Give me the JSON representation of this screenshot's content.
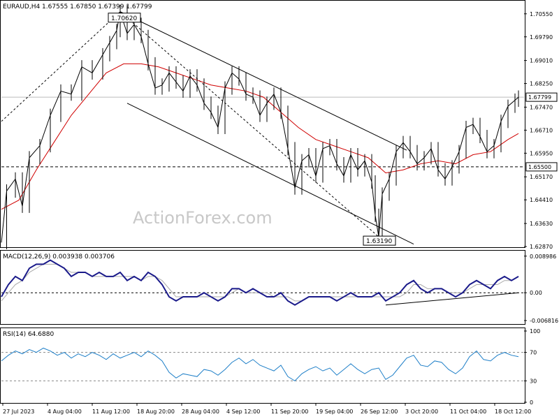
{
  "chart_data": [
    {
      "panel": "price",
      "type": "candlestick",
      "header": "EURAUD,H4  1.67555 1.67850 1.67399 1.67799",
      "watermark": "ActionForex.com",
      "y_ticks": [
        "1.70550",
        "1.69790",
        "1.69010",
        "1.68250",
        "1.67470",
        "1.66710",
        "1.65950",
        "1.65170",
        "1.64410",
        "1.63630",
        "1.62870"
      ],
      "ylim": [
        1.6287,
        1.7096
      ],
      "x_ticks": [
        "27 Jul 2023",
        "4 Aug 04:00",
        "11 Aug 12:00",
        "18 Aug 20:00",
        "28 Aug 04:00",
        "4 Sep 12:00",
        "11 Sep 20:00",
        "19 Sep 04:00",
        "26 Sep 12:00",
        "3 Oct 20:00",
        "11 Oct 04:00",
        "18 Oct 12:00"
      ],
      "price_points": [
        {
          "x": 0,
          "y": 1.63
        },
        {
          "x": 3,
          "y": 1.647
        },
        {
          "x": 8,
          "y": 1.651
        },
        {
          "x": 12,
          "y": 1.642
        },
        {
          "x": 16,
          "y": 1.658
        },
        {
          "x": 22,
          "y": 1.662
        },
        {
          "x": 28,
          "y": 1.672
        },
        {
          "x": 34,
          "y": 1.68
        },
        {
          "x": 40,
          "y": 1.679
        },
        {
          "x": 46,
          "y": 1.688
        },
        {
          "x": 52,
          "y": 1.686
        },
        {
          "x": 58,
          "y": 1.692
        },
        {
          "x": 62,
          "y": 1.696
        },
        {
          "x": 66,
          "y": 1.7
        },
        {
          "x": 68,
          "y": 1.7062
        },
        {
          "x": 72,
          "y": 1.699
        },
        {
          "x": 76,
          "y": 1.702
        },
        {
          "x": 80,
          "y": 1.698
        },
        {
          "x": 84,
          "y": 1.689
        },
        {
          "x": 88,
          "y": 1.681
        },
        {
          "x": 92,
          "y": 1.682
        },
        {
          "x": 96,
          "y": 1.686
        },
        {
          "x": 100,
          "y": 1.683
        },
        {
          "x": 104,
          "y": 1.68
        },
        {
          "x": 108,
          "y": 1.685
        },
        {
          "x": 112,
          "y": 1.682
        },
        {
          "x": 116,
          "y": 1.676
        },
        {
          "x": 120,
          "y": 1.673
        },
        {
          "x": 124,
          "y": 1.668
        },
        {
          "x": 128,
          "y": 1.681
        },
        {
          "x": 132,
          "y": 1.686
        },
        {
          "x": 136,
          "y": 1.684
        },
        {
          "x": 140,
          "y": 1.679
        },
        {
          "x": 144,
          "y": 1.678
        },
        {
          "x": 148,
          "y": 1.672
        },
        {
          "x": 152,
          "y": 1.676
        },
        {
          "x": 156,
          "y": 1.679
        },
        {
          "x": 160,
          "y": 1.673
        },
        {
          "x": 164,
          "y": 1.661
        },
        {
          "x": 168,
          "y": 1.648
        },
        {
          "x": 172,
          "y": 1.657
        },
        {
          "x": 176,
          "y": 1.659
        },
        {
          "x": 180,
          "y": 1.652
        },
        {
          "x": 184,
          "y": 1.661
        },
        {
          "x": 188,
          "y": 1.662
        },
        {
          "x": 192,
          "y": 1.656
        },
        {
          "x": 196,
          "y": 1.652
        },
        {
          "x": 200,
          "y": 1.659
        },
        {
          "x": 204,
          "y": 1.654
        },
        {
          "x": 208,
          "y": 1.657
        },
        {
          "x": 212,
          "y": 1.65
        },
        {
          "x": 214,
          "y": 1.639
        },
        {
          "x": 216,
          "y": 1.6319
        },
        {
          "x": 218,
          "y": 1.646
        },
        {
          "x": 222,
          "y": 1.651
        },
        {
          "x": 226,
          "y": 1.66
        },
        {
          "x": 230,
          "y": 1.663
        },
        {
          "x": 234,
          "y": 1.66
        },
        {
          "x": 238,
          "y": 1.656
        },
        {
          "x": 242,
          "y": 1.658
        },
        {
          "x": 246,
          "y": 1.661
        },
        {
          "x": 250,
          "y": 1.654
        },
        {
          "x": 254,
          "y": 1.651
        },
        {
          "x": 258,
          "y": 1.655
        },
        {
          "x": 262,
          "y": 1.66
        },
        {
          "x": 266,
          "y": 1.668
        },
        {
          "x": 270,
          "y": 1.669
        },
        {
          "x": 274,
          "y": 1.665
        },
        {
          "x": 278,
          "y": 1.66
        },
        {
          "x": 282,
          "y": 1.662
        },
        {
          "x": 286,
          "y": 1.67
        },
        {
          "x": 290,
          "y": 1.675
        },
        {
          "x": 294,
          "y": 1.677
        },
        {
          "x": 296,
          "y": 1.678
        }
      ],
      "ma_points": [
        {
          "x": 0,
          "y": 1.641
        },
        {
          "x": 10,
          "y": 1.644
        },
        {
          "x": 20,
          "y": 1.654
        },
        {
          "x": 30,
          "y": 1.663
        },
        {
          "x": 40,
          "y": 1.672
        },
        {
          "x": 50,
          "y": 1.679
        },
        {
          "x": 60,
          "y": 1.686
        },
        {
          "x": 70,
          "y": 1.689
        },
        {
          "x": 80,
          "y": 1.689
        },
        {
          "x": 90,
          "y": 1.688
        },
        {
          "x": 100,
          "y": 1.686
        },
        {
          "x": 110,
          "y": 1.684
        },
        {
          "x": 120,
          "y": 1.682
        },
        {
          "x": 130,
          "y": 1.681
        },
        {
          "x": 140,
          "y": 1.68
        },
        {
          "x": 150,
          "y": 1.678
        },
        {
          "x": 160,
          "y": 1.673
        },
        {
          "x": 170,
          "y": 1.668
        },
        {
          "x": 180,
          "y": 1.664
        },
        {
          "x": 190,
          "y": 1.662
        },
        {
          "x": 200,
          "y": 1.66
        },
        {
          "x": 210,
          "y": 1.658
        },
        {
          "x": 220,
          "y": 1.653
        },
        {
          "x": 230,
          "y": 1.654
        },
        {
          "x": 240,
          "y": 1.656
        },
        {
          "x": 250,
          "y": 1.657
        },
        {
          "x": 260,
          "y": 1.656
        },
        {
          "x": 270,
          "y": 1.659
        },
        {
          "x": 280,
          "y": 1.66
        },
        {
          "x": 290,
          "y": 1.664
        },
        {
          "x": 296,
          "y": 1.666
        }
      ],
      "channel_lines": [
        {
          "from": {
            "x": 68,
            "y": 1.7062
          },
          "to": {
            "x": 232,
            "y": 1.6605
          }
        },
        {
          "from": {
            "x": 72,
            "y": 1.676
          },
          "to": {
            "x": 236,
            "y": 1.6295
          }
        }
      ],
      "zigzag_lines": [
        {
          "from": {
            "x": 0,
            "y": 1.67
          },
          "to": {
            "x": 68,
            "y": 1.7062
          }
        },
        {
          "from": {
            "x": 68,
            "y": 1.7062
          },
          "to": {
            "x": 216,
            "y": 1.6319
          }
        }
      ],
      "h_lines": [
        {
          "y": 1.67799,
          "style": "solid",
          "color": "#bbbbbb"
        },
        {
          "y": 1.655,
          "style": "dashed",
          "color": "#000000"
        }
      ],
      "tags": [
        {
          "text": "1.70620",
          "x": 62,
          "y": 1.7055
        },
        {
          "text": "1.63190",
          "x": 208,
          "y": 1.6319
        }
      ],
      "right_tags": [
        "1.67799",
        "1.65500"
      ]
    },
    {
      "panel": "macd",
      "type": "line",
      "header": "MACD(12,26,9) 0.003938 0.003706",
      "y_ticks": [
        "0.008986",
        "0.00",
        "-0.006816"
      ],
      "ylim": [
        -0.0075,
        0.0098
      ],
      "series": [
        {
          "values": [
            -0.001,
            0.002,
            0.004,
            0.003,
            0.006,
            0.007,
            0.007,
            0.008,
            0.007,
            0.006,
            0.004,
            0.005,
            0.005,
            0.004,
            0.005,
            0.004,
            0.004,
            0.005,
            0.003,
            0.004,
            0.003,
            0.005,
            0.004,
            0.002,
            -0.001,
            -0.002,
            -0.001,
            -0.001,
            -0.001,
            0.0,
            -0.001,
            -0.002,
            -0.001,
            0.001,
            0.001,
            0.0,
            0.001,
            0.0,
            -0.001,
            -0.001,
            0.0,
            -0.002,
            -0.003,
            -0.002,
            -0.001,
            -0.001,
            -0.001,
            -0.001,
            -0.002,
            -0.001,
            0.0,
            -0.001,
            -0.001,
            -0.001,
            0.0,
            -0.002,
            -0.001,
            0.0,
            0.002,
            0.003,
            0.001,
            0.0,
            0.001,
            0.001,
            0.0,
            -0.001,
            0.0,
            0.002,
            0.003,
            0.002,
            0.001,
            0.003,
            0.004,
            0.003,
            0.004
          ]
        },
        {
          "values": [
            -0.002,
            0.0,
            0.002,
            0.003,
            0.005,
            0.006,
            0.007,
            0.007,
            0.007,
            0.006,
            0.005,
            0.005,
            0.005,
            0.004,
            0.004,
            0.004,
            0.004,
            0.004,
            0.004,
            0.004,
            0.003,
            0.004,
            0.004,
            0.003,
            0.001,
            -0.001,
            -0.001,
            -0.001,
            -0.001,
            -0.001,
            -0.001,
            -0.001,
            -0.001,
            0.0,
            0.001,
            0.0,
            0.0,
            0.0,
            0.0,
            -0.001,
            -0.001,
            -0.001,
            -0.002,
            -0.002,
            -0.001,
            -0.001,
            -0.001,
            -0.001,
            -0.001,
            -0.001,
            -0.001,
            -0.001,
            -0.001,
            -0.001,
            -0.001,
            -0.001,
            -0.001,
            -0.001,
            0.0,
            0.002,
            0.002,
            0.001,
            0.001,
            0.001,
            0.0,
            0.0,
            0.0,
            0.001,
            0.002,
            0.002,
            0.002,
            0.002,
            0.003,
            0.003,
            0.004
          ]
        }
      ],
      "trendline": {
        "from": {
          "x": 55,
          "y": -0.003
        },
        "to": {
          "x": 74,
          "y": 0.0
        }
      }
    },
    {
      "panel": "rsi",
      "type": "line",
      "header": "RSI(14) 64.6880",
      "y_ticks": [
        "100",
        "70",
        "30",
        "0"
      ],
      "ylim": [
        0,
        100
      ],
      "levels": [
        70,
        30
      ],
      "values": [
        58,
        66,
        72,
        68,
        74,
        70,
        76,
        72,
        66,
        70,
        62,
        68,
        64,
        70,
        66,
        60,
        68,
        62,
        66,
        70,
        64,
        72,
        66,
        58,
        42,
        34,
        40,
        38,
        36,
        46,
        44,
        38,
        46,
        56,
        62,
        54,
        60,
        52,
        48,
        44,
        52,
        36,
        30,
        40,
        46,
        50,
        44,
        48,
        38,
        46,
        54,
        46,
        40,
        46,
        48,
        32,
        38,
        50,
        62,
        66,
        52,
        50,
        58,
        56,
        46,
        40,
        48,
        64,
        72,
        60,
        58,
        66,
        70,
        66,
        64
      ]
    }
  ]
}
